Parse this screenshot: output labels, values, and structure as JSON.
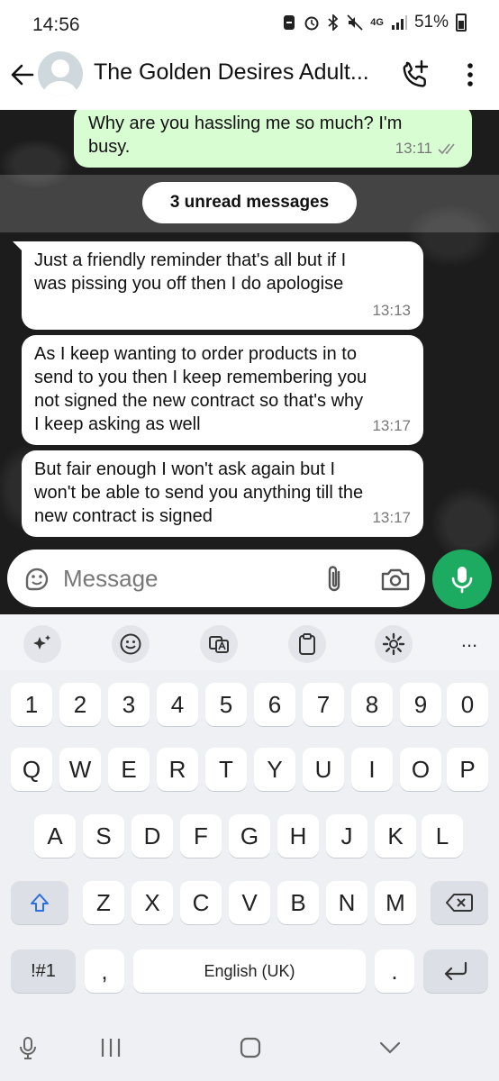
{
  "status_bar": {
    "time": "14:56",
    "network": "4G",
    "battery": "51%",
    "icons": [
      "dnd-icon",
      "alarm-icon",
      "bluetooth-icon",
      "mute-icon",
      "signal-icon",
      "battery-icon"
    ]
  },
  "header": {
    "title": "The Golden Desires Adult...",
    "icons": [
      "back-arrow-icon",
      "avatar",
      "add-call-icon",
      "more-vert-icon"
    ]
  },
  "messages": [
    {
      "direction": "out",
      "text_lines": [
        "Why are you hassling me so much? I'm",
        "busy."
      ],
      "time": "13:11",
      "status": "read-ticks"
    },
    {
      "direction": "in",
      "text_lines": [
        "Just a friendly reminder that's all but if I",
        "was pissing you off then I do apologise"
      ],
      "time": "13:13"
    },
    {
      "direction": "in",
      "text_lines": [
        "As I keep wanting to order products in to",
        "send to you then I keep remembering you",
        "not signed the new contract so that's why",
        "I keep asking as well"
      ],
      "time": "13:17"
    },
    {
      "direction": "in",
      "text_lines": [
        "But fair enough I won't ask again but I",
        "won't be able to send you anything till the",
        "new contract is signed"
      ],
      "time": "13:17"
    }
  ],
  "unread_label": "3 unread messages",
  "composer": {
    "placeholder": "Message",
    "icons": [
      "sticker-icon",
      "attach-icon",
      "camera-icon",
      "mic-icon"
    ]
  },
  "keyboard": {
    "toolbar_icons": [
      "ai-sparkle-icon",
      "emoji-icon",
      "translate-icon",
      "clipboard-icon",
      "settings-icon",
      "more-icon"
    ],
    "more_label": "...",
    "row_numbers": [
      "1",
      "2",
      "3",
      "4",
      "5",
      "6",
      "7",
      "8",
      "9",
      "0"
    ],
    "row_q": [
      "Q",
      "W",
      "E",
      "R",
      "T",
      "Y",
      "U",
      "I",
      "O",
      "P"
    ],
    "row_a": [
      "A",
      "S",
      "D",
      "F",
      "G",
      "H",
      "J",
      "K",
      "L"
    ],
    "row_z": [
      "Z",
      "X",
      "C",
      "V",
      "B",
      "N",
      "M"
    ],
    "symbols_label": "!#1",
    "comma": ",",
    "space_label": "English (UK)",
    "period": "."
  },
  "nav_bar": {
    "icons": [
      "voice-input-icon",
      "recent-apps-icon",
      "home-icon",
      "hide-keyboard-icon"
    ]
  },
  "colors": {
    "outgoing_bubble": "#d9fdd3",
    "incoming_bubble": "#ffffff",
    "accent_green": "#1daa61",
    "chat_background": "#1c1c1c",
    "keyboard_bg": "#eef0f4"
  }
}
